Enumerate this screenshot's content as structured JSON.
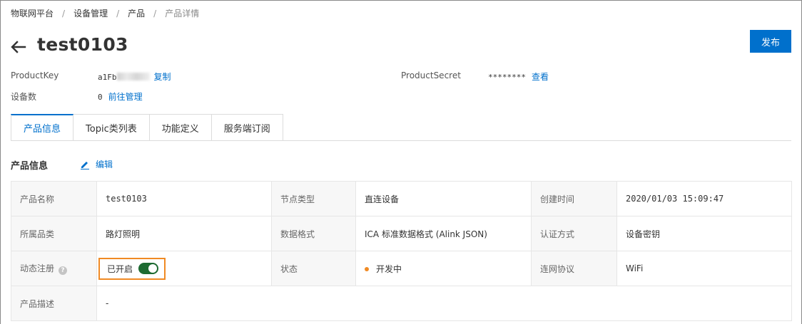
{
  "breadcrumb": [
    "物联网平台",
    "设备管理",
    "产品",
    "产品详情"
  ],
  "header": {
    "title": "test0103",
    "publish_label": "发布"
  },
  "meta": {
    "product_key_label": "ProductKey",
    "product_key_value": "a1Fb",
    "copy_label": "复制",
    "product_secret_label": "ProductSecret",
    "product_secret_value": "********",
    "view_label": "查看",
    "device_count_label": "设备数",
    "device_count_value": "0",
    "manage_label": "前往管理"
  },
  "tabs": [
    {
      "label": "产品信息",
      "active": true
    },
    {
      "label": "Topic类列表",
      "active": false
    },
    {
      "label": "功能定义",
      "active": false
    },
    {
      "label": "服务端订阅",
      "active": false
    }
  ],
  "section": {
    "title": "产品信息",
    "edit_label": "编辑"
  },
  "info": {
    "product_name_label": "产品名称",
    "product_name_value": "test0103",
    "node_type_label": "节点类型",
    "node_type_value": "直连设备",
    "created_label": "创建时间",
    "created_value": "2020/01/03 15:09:47",
    "category_label": "所属品类",
    "category_value": "路灯照明",
    "data_format_label": "数据格式",
    "data_format_value": "ICA 标准数据格式 (Alink JSON)",
    "auth_label": "认证方式",
    "auth_value": "设备密钥",
    "dynamic_reg_label": "动态注册",
    "dynamic_reg_value": "已开启",
    "dynamic_reg_enabled": true,
    "status_label": "状态",
    "status_value": "开发中",
    "protocol_label": "连网协议",
    "protocol_value": "WiFi",
    "description_label": "产品描述",
    "description_value": "-"
  },
  "colors": {
    "primary": "#0070cc",
    "switch_on": "#1e6b32",
    "highlight": "#f08a24",
    "status_dot": "#f08a24"
  }
}
